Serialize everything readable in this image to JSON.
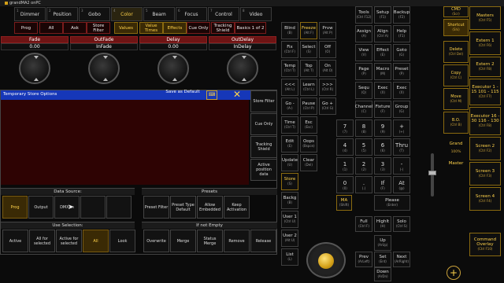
{
  "window": {
    "title": "grandMA2 onPC"
  },
  "header": {
    "left_buttons": [
      {
        "label": "Prog",
        "sel": false
      },
      {
        "label": "All",
        "sel": false
      },
      {
        "label": "Ask",
        "sel": false
      },
      {
        "label": "Store Filter",
        "sel": false
      },
      {
        "label": "Values",
        "sel": true
      },
      {
        "label": "Value Times",
        "sel": true
      },
      {
        "label": "Effects",
        "sel": true
      },
      {
        "label": "Cue Only",
        "sel": false
      },
      {
        "label": "Tracking Shield",
        "sel": false
      },
      {
        "label": "Basics 1 of 2",
        "sel": false
      }
    ]
  },
  "tabs": [
    {
      "n": "1",
      "label": "Dimmer"
    },
    {
      "n": "2",
      "label": "Position"
    },
    {
      "n": "3",
      "label": "Gobo"
    },
    {
      "n": "4",
      "label": "Color",
      "sel": true
    },
    {
      "n": "5",
      "label": "Beam"
    },
    {
      "n": "6",
      "label": "Focus"
    },
    {
      "n": "7",
      "label": "Control"
    },
    {
      "n": "8",
      "label": "Video"
    }
  ],
  "faders": [
    {
      "name": "Fade",
      "value": "0.00"
    },
    {
      "name": "OutFade",
      "value": "InFade"
    },
    {
      "name": "Delay",
      "value": "0.00"
    },
    {
      "name": "OutDelay",
      "value": "InDelay"
    }
  ],
  "dialog": {
    "title": "Temporary Store Options",
    "save_default": "Save as Default",
    "side": [
      "Store Filter",
      "Cue Only",
      "Tracking Shield",
      "Active position data"
    ],
    "data_source": {
      "title": "Data Source:",
      "items": [
        "Prog",
        "Output",
        "DMX In",
        "",
        ""
      ],
      "selected": 0
    },
    "presets": {
      "title": "Presets",
      "items": [
        "Preset Filter",
        "Preset Type Default",
        "Allow Embedded",
        "Keep Activation"
      ]
    },
    "use_selection": {
      "title": "Use Selection:",
      "items": [
        "Active",
        "All for selected",
        "Active for selected",
        "All",
        "Look"
      ],
      "selected": 3
    },
    "if_not_empty": {
      "title": "If not Empty",
      "items": [
        "Overwrite",
        "Merge",
        "Status Merge",
        "Remove",
        "Release"
      ]
    }
  },
  "keys": {
    "col1": [
      {
        "l": "Blind",
        "s": "(B)"
      },
      {
        "l": "Fix",
        "s": "(Ctrl F)"
      },
      {
        "l": "Temp",
        "s": "(Ctrl T)"
      },
      {
        "l": "<<<",
        "s": "(Alt L)"
      },
      {
        "l": "Go -",
        "s": "(A-)"
      },
      {
        "l": "Time",
        "s": "(Ctrl T)"
      },
      {
        "l": "Edit",
        "s": "(E)"
      },
      {
        "l": "Update",
        "s": "(U)"
      },
      {
        "l": "Store",
        "s": "(S)"
      },
      {
        "l": "Backg",
        "s": "(B)"
      },
      {
        "l": "User 1",
        "s": "(Ctrl U)"
      },
      {
        "l": "User 2",
        "s": "(Alt U)"
      },
      {
        "l": "List",
        "s": "(L)"
      }
    ],
    "col2": [
      {
        "l": "Freeze",
        "s": "(Alt F)"
      },
      {
        "l": "Select",
        "s": "(S)"
      },
      {
        "l": "Top",
        "s": "(Alt T)"
      },
      {
        "l": "Learn",
        "s": "(Ctrl L)"
      },
      {
        "l": "Pause",
        "s": "(Ctrl P)"
      },
      {
        "l": "Esc",
        "s": "(Esc)"
      },
      {
        "l": "Oops",
        "s": "(Bspce)"
      },
      {
        "l": "Clear",
        "s": "(Del)"
      }
    ],
    "col3": [
      {
        "l": "Prvw",
        "s": "(Alt P)"
      },
      {
        "l": "Off",
        "s": "(O)"
      },
      {
        "l": "On",
        "s": "(Alt O)"
      },
      {
        "l": ">>>",
        "s": "(Ctrl R)"
      },
      {
        "l": "Go +",
        "s": "(Ctrl G)"
      }
    ],
    "right1": [
      {
        "l": "Tools",
        "s": "(Ctrl F12)"
      },
      {
        "l": "Assign",
        "s": "(A)"
      },
      {
        "l": "View",
        "s": "(V)"
      },
      {
        "l": "Page",
        "s": "(P)"
      },
      {
        "l": "Sequ",
        "s": "(Q)"
      },
      {
        "l": "Channel",
        "s": "(C)"
      }
    ],
    "right2": [
      {
        "l": "Setup",
        "s": "(F1)"
      },
      {
        "l": "Align",
        "s": "(Ctrl A)"
      },
      {
        "l": "Effect",
        "s": "(E)"
      },
      {
        "l": "Macro",
        "s": "(M)"
      },
      {
        "l": "Exec",
        "s": "(X)"
      },
      {
        "l": "Fixture",
        "s": "(F)"
      }
    ],
    "right3": [
      {
        "l": "Backup",
        "s": "(F2)"
      },
      {
        "l": "Help",
        "s": "(F1)"
      },
      {
        "l": "Goto",
        "s": "(G)"
      },
      {
        "l": "Preset",
        "s": "(P)"
      },
      {
        "l": "Exec",
        "s": "(X)"
      },
      {
        "l": "Group",
        "s": "(G)"
      }
    ],
    "numpad": [
      [
        "7",
        "8",
        "9",
        "+"
      ],
      [
        "4",
        "5",
        "6",
        "Thru"
      ],
      [
        "1",
        "2",
        "3",
        "-"
      ],
      [
        "0",
        ".",
        "If",
        "At"
      ]
    ],
    "numpad_sub": [
      [
        "(7)",
        "(8)",
        "(9)",
        "(+)"
      ],
      [
        "(4)",
        "(5)",
        "(6)",
        "(T)"
      ],
      [
        "(1)",
        "(2)",
        "(3)",
        "(-)"
      ],
      [
        "(0)",
        "(.)",
        "(F)",
        "(@)"
      ]
    ],
    "ma": {
      "l": "MA",
      "s": "(Shift)"
    },
    "please": {
      "l": "Please",
      "s": "(Enter)"
    },
    "bottom": [
      {
        "l": "Full",
        "s": "(Ctrl F)"
      },
      {
        "l": "Highlt",
        "s": "(H)"
      },
      {
        "l": "Solo",
        "s": "(Ctrl S)"
      },
      {
        "l": "Up",
        "s": "(ArUp)"
      },
      {
        "l": "Prev",
        "s": "(ArLeft)"
      },
      {
        "l": "Set",
        "s": "(Ent)"
      },
      {
        "l": "Next",
        "s": "(ArRight)"
      },
      {
        "l": "Down",
        "s": "(ArDn)"
      }
    ]
  },
  "right_panel": {
    "cmd": {
      "l": "CMD",
      "s": "(Scr)"
    },
    "shortcut": {
      "l": "Shortcut",
      "s": "(Shi)"
    },
    "side": [
      {
        "l": "Delete",
        "s": "(Ctrl Del)"
      },
      {
        "l": "Copy",
        "s": "(Ctrl C)"
      },
      {
        "l": "Move",
        "s": "(Ctrl M)"
      },
      {
        "l": "B.O.",
        "s": "(Ctrl B)"
      }
    ],
    "grand": "Grand",
    "grand_pct": "100%",
    "master": "Master",
    "fkeys": [
      {
        "l": "Masters",
        "s": "(Ctrl F5)"
      },
      {
        "l": "Extern 1",
        "s": "(Ctrl F6)"
      },
      {
        "l": "Extern 2",
        "s": "(Ctrl F8)"
      },
      {
        "l": "Executor 1 - 15 101 - 115",
        "s": "(Ctrl F7)"
      },
      {
        "l": "Executor 16 - 30 116 - 130",
        "s": "(Ctrl F8)"
      },
      {
        "l": "Screen 2",
        "s": "(Ctrl F2)"
      },
      {
        "l": "Screen 3",
        "s": "(Ctrl F3)"
      },
      {
        "l": "Screen 4",
        "s": "(Ctrl F4)"
      },
      {
        "l": "Command Overlay",
        "s": "(Ctrl F10)"
      }
    ]
  },
  "colors": {
    "accent": "#ffd24a",
    "dialog_blue": "#1637b8",
    "fader_red": "#6e1414"
  }
}
